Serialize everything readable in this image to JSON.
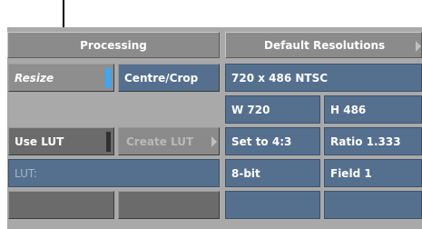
{
  "tabs": {
    "processing": "Processing",
    "default_resolutions": "Default Resolutions"
  },
  "buttons": {
    "resize": "Resize",
    "centre_crop": "Centre/Crop",
    "use_lut": "Use LUT",
    "create_lut": "Create LUT"
  },
  "fields": {
    "resolution": "720 x 486 NTSC",
    "width": "W 720",
    "height": "H 486",
    "set_aspect": "Set to 4:3",
    "ratio": "Ratio 1.333",
    "lut_label": "LUT:",
    "bit_depth": "8-bit",
    "field": "Field 1"
  },
  "colors": {
    "indicator_on": "#37a9ff",
    "field_blue": "#55708f",
    "panel_gray": "#a9a9a9"
  }
}
